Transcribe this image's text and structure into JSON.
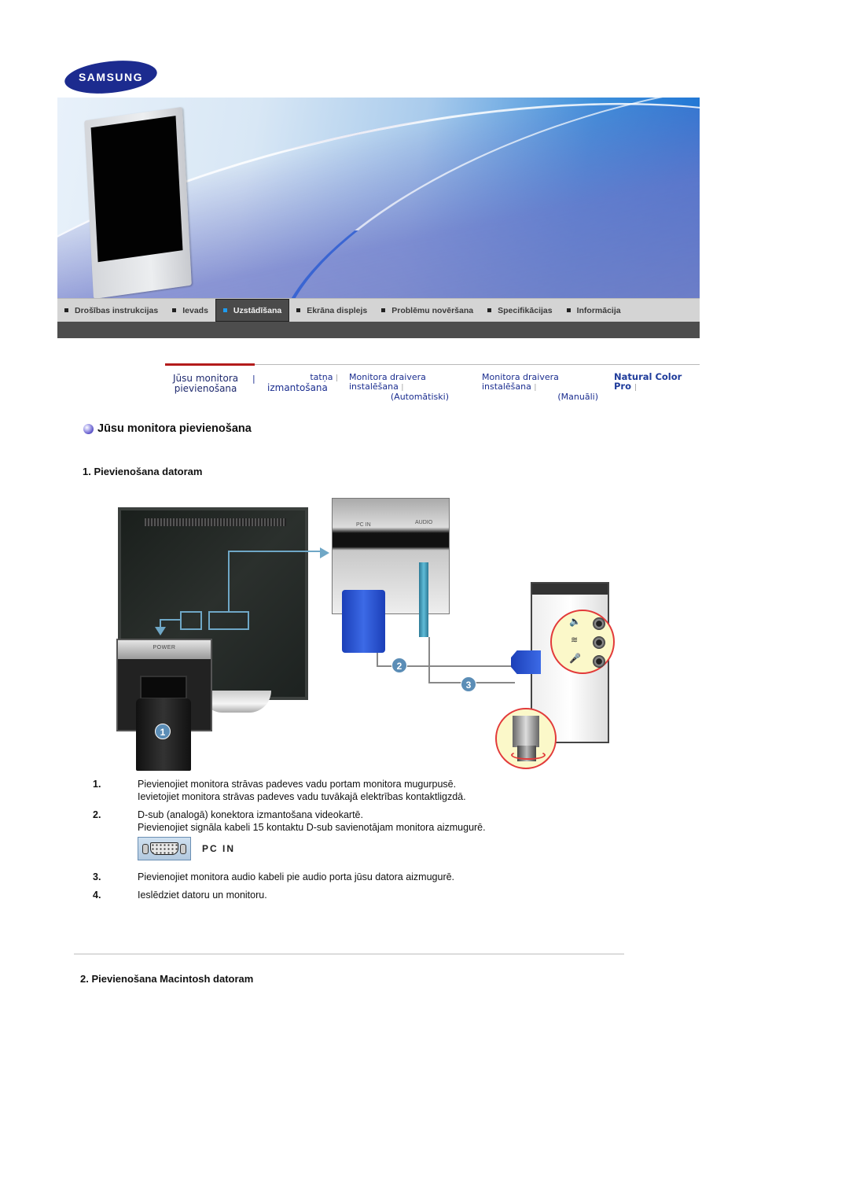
{
  "logo": {
    "text": "SAMSUNG",
    "brand_color": "#1c2b8f"
  },
  "nav": {
    "items": [
      {
        "label": "Drošības instrukcijas",
        "active": false
      },
      {
        "label": "Ievads",
        "active": false
      },
      {
        "label": "Uzstādīšana",
        "active": true
      },
      {
        "label": "Ekrāna displejs",
        "active": false
      },
      {
        "label": "Problēmu novēršana",
        "active": false
      },
      {
        "label": "Specifikācijas",
        "active": false
      },
      {
        "label": "Informācija",
        "active": false
      }
    ],
    "active_color": "#1e9cf0"
  },
  "subnav": {
    "items": [
      {
        "line1": "Jūsu monitora",
        "line2": "pievienošana"
      },
      {
        "line1": "tatņa",
        "line2": "izmantošana"
      },
      {
        "line1": "Monitora draivera instalēšana",
        "line2": "(Automātiski)"
      },
      {
        "line1": "Monitora draivera instalēšana",
        "line2": "(Manuāli)"
      },
      {
        "line1": "Natural Color Pro",
        "line2": ""
      }
    ],
    "separator": "|"
  },
  "page": {
    "title": "Jūsu monitora pievienošana",
    "section1": "1. Pievienošana datoram",
    "section2": "2. Pievienošana Macintosh datoram"
  },
  "diagram": {
    "labels": {
      "power": "POWER",
      "pc_in": "PC IN",
      "audio": "AUDIO"
    },
    "badges": [
      "1",
      "2",
      "3"
    ]
  },
  "steps": [
    {
      "num": "1.",
      "lines": [
        "Pievienojiet monitora strāvas padeves vadu portam monitora mugurpusē.",
        "Ievietojiet monitora strāvas padeves vadu tuvākajā elektrības kontaktligzdā."
      ]
    },
    {
      "num": "2.",
      "lines": [
        "D-sub (analogā) konektora izmantošana videokartē.",
        "Pievienojiet signāla kabeli 15 kontaktu D-sub savienotājam monitora aizmugurē."
      ],
      "port_label": "PC  IN"
    },
    {
      "num": "3.",
      "lines": [
        "Pievienojiet monitora audio kabeli pie audio porta jūsu datora aizmugurē."
      ]
    },
    {
      "num": "4.",
      "lines": [
        "Ieslēdziet datoru un monitoru."
      ]
    }
  ]
}
